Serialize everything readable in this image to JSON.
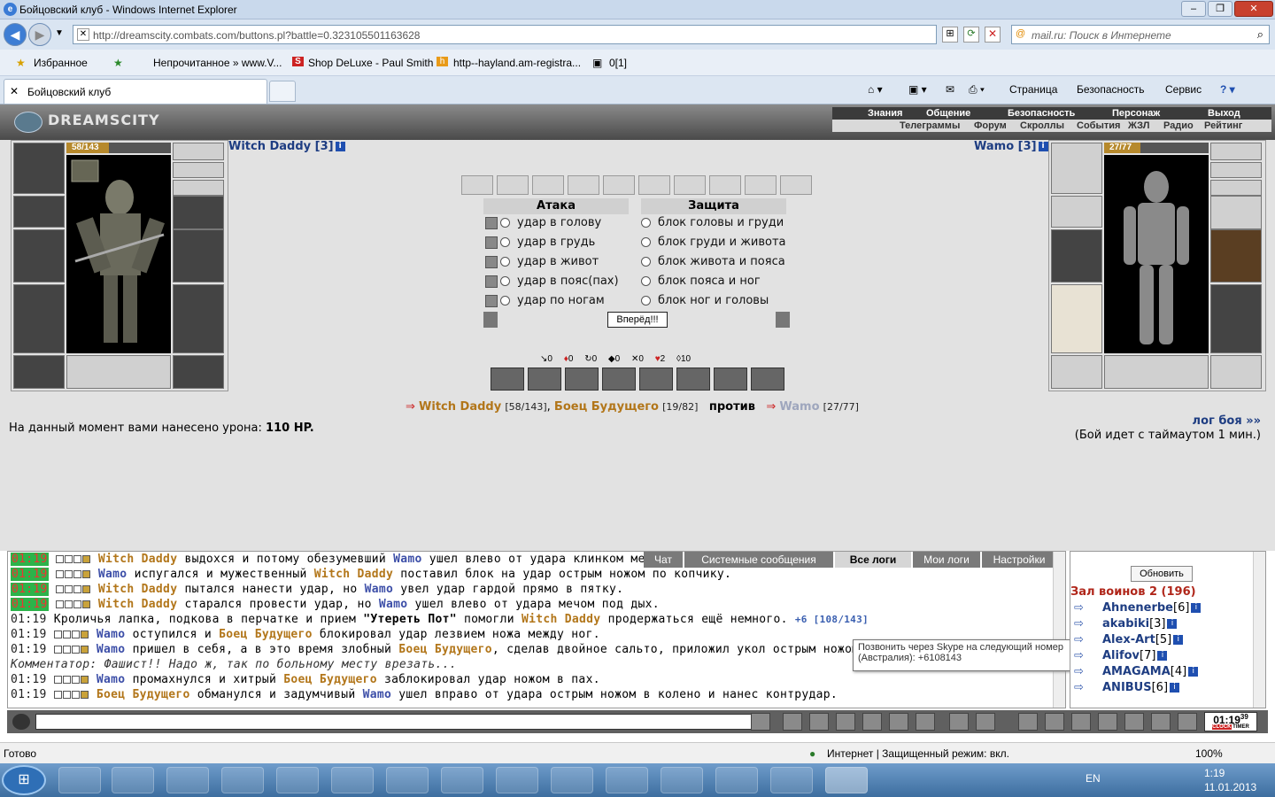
{
  "window": {
    "title": "Бойцовский клуб - Windows Internet Explorer",
    "min": "–",
    "max": "❐",
    "close": "✕"
  },
  "nav": {
    "address": "http://dreamscity.combats.com/buttons.pl?battle=0.323105501163628",
    "search_placeholder": "mail.ru: Поиск в Интернете"
  },
  "favorites": {
    "fav_label": "Избранное",
    "items": [
      "Непрочитанное » www.V...",
      "Shop DeLuxe - Paul Smith",
      "http--hayland.am-registra...",
      "0[1]"
    ]
  },
  "tab": {
    "title": "Бойцовский клуб"
  },
  "commandbar": {
    "page": "Страница",
    "security": "Безопасность",
    "service": "Сервис"
  },
  "game": {
    "logo": "DREAMSCITY",
    "menu_top": [
      "Знания",
      "Общение",
      "Безопасность",
      "Персонаж",
      "Выход"
    ],
    "menu_bottom": [
      "Телеграммы",
      "Форум",
      "Скроллы",
      "События",
      "ЖЗЛ",
      "Радио",
      "Рейтинг"
    ],
    "left_player": {
      "name": "Witch Daddy [3]",
      "hp_text": "58/143",
      "hp_fraction": 0.405
    },
    "right_player": {
      "name": "Wamo [3]",
      "hp_text": "27/77",
      "hp_fraction": 0.35
    },
    "attack_header": "Атака",
    "defense_header": "Защита",
    "attacks": [
      "удар в голову",
      "удар в грудь",
      "удар в живот",
      "удар в пояс(пах)",
      "удар по ногам"
    ],
    "defenses": [
      "блок головы и груди",
      "блок груди и живота",
      "блок живота и пояса",
      "блок пояса и ног",
      "блок ног и головы"
    ],
    "go_button": "Вперёд!!!",
    "stats": [
      "0",
      "0",
      "0",
      "0",
      "0",
      "2",
      "10"
    ],
    "vs": {
      "team1_a": "Witch Daddy",
      "team1_a_hp": "[58/143]",
      "team1_b": "Боец Будущего",
      "team1_b_hp": "[19/82]",
      "vs_word": "против",
      "team2": "Wamo",
      "team2_hp": "[27/77]"
    },
    "damage_text": "На данный момент вами нанесено урона:",
    "damage_value": "110 HP.",
    "log_link": "лог боя »»",
    "timeout_text": "(Бой идет с таймаутом 1 мин.)"
  },
  "chat": {
    "tabs": [
      "Чат",
      "Системные сообщения",
      "Все логи",
      "Мои логи",
      "Настройки"
    ],
    "lines": [
      {
        "time": "01:19",
        "a": "Witch Daddy",
        "t1": " выдохся и потому обезумевший ",
        "b": "Wamo",
        "t2": " ушел влево от удара клинком меч"
      },
      {
        "time": "01:19",
        "a": "Wamo",
        "t1": " испугался и мужественный ",
        "b": "Witch Daddy",
        "t2": " поставил блок на удар острым ножом по копчику."
      },
      {
        "time": "01:19",
        "a": "Witch Daddy",
        "t1": " пытался нанести удар, но ",
        "b": "Wamo",
        "t2": " увел удар гардой прямо в пятку."
      },
      {
        "time": "01:19",
        "a": "Witch Daddy",
        "t1": " старался провести удар, но ",
        "b": "Wamo",
        "t2": " ушел влево от удара мечом под дых."
      },
      {
        "time": "01:19",
        "pre": "Кроличья лапка, подкова в перчатке и прием ",
        "q": "\"Утереть Пот\"",
        "mid": " помогли ",
        "a": "Witch Daddy",
        "t2": " продержаться ещё немного.",
        "heal": "+6 [108/143]"
      },
      {
        "time": "01:19",
        "a": "Wamo",
        "t1": " оступился и ",
        "b": "Боец Будущего",
        "t2": " блокировал удар лезвием ножа между ног."
      },
      {
        "time": "01:19",
        "a": "Wamo",
        "t1": " пришел в себя, а в это время злобный ",
        "b": "Боец Будущего",
        "t2": ", сделав двойное сальто, приложил укол острым ножом в г"
      },
      {
        "comment": "Комментатор: Фашист!! Надо ж, так по больному месту врезать..."
      },
      {
        "time": "01:19",
        "a": "Wamo",
        "t1": " промахнулся и хитрый ",
        "b": "Боец Будущего",
        "t2": " заблокировал удар ножом в пах."
      },
      {
        "time": "01:19",
        "a": "Боец Будущего",
        "t1": " обманулся и задумчивый ",
        "b": "Wamo",
        "t2": " ушел вправо от удара острым ножом в колено и нанес контрудар."
      }
    ],
    "tooltip": "Позвонить через Skype на следующий номер (Австралия): +6108143"
  },
  "room": {
    "refresh": "Обновить",
    "title": "Зал воинов 2 (196)",
    "players": [
      {
        "name": "Ahnenerbe",
        "lvl": "[6]"
      },
      {
        "name": "akabiki",
        "lvl": "[3]"
      },
      {
        "name": "Alex-Art",
        "lvl": "[5]"
      },
      {
        "name": "Alifov",
        "lvl": "[7]"
      },
      {
        "name": "AMAGAMA",
        "lvl": "[4]"
      },
      {
        "name": "ANIBUS",
        "lvl": "[6]"
      }
    ]
  },
  "clock": {
    "time": "01:19",
    "seconds": "39",
    "clock_label": "CLOCK",
    "timer_label": "TIMER"
  },
  "statusbar": {
    "left": "Готово",
    "zone": "Интернет | Защищенный режим: вкл.",
    "zoom": "100%"
  },
  "taskbar": {
    "lang": "EN",
    "time": "1:19",
    "date": "11.01.2013"
  }
}
